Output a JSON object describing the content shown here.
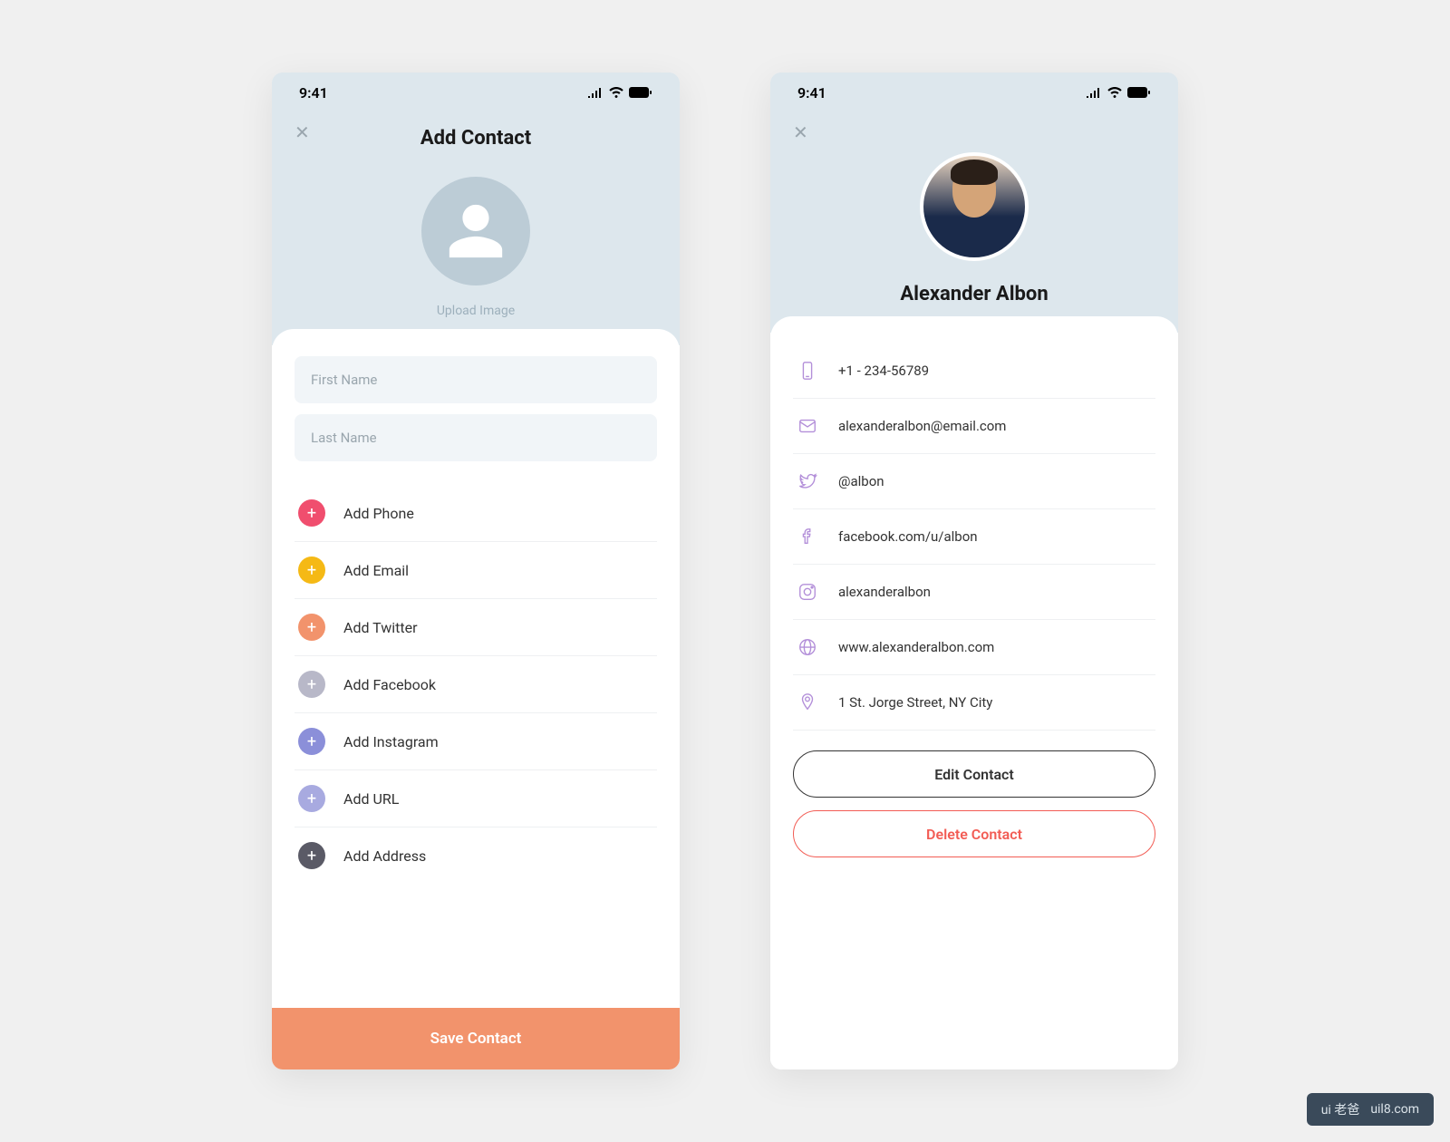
{
  "status": {
    "time": "9:41"
  },
  "screen1": {
    "title": "Add Contact",
    "upload_label": "Upload Image",
    "inputs": {
      "first_name_placeholder": "First Name",
      "last_name_placeholder": "Last Name"
    },
    "add_items": [
      {
        "label": "Add Phone",
        "color": "#f04e6e"
      },
      {
        "label": "Add Email",
        "color": "#f5b915"
      },
      {
        "label": "Add Twitter",
        "color": "#f2936c"
      },
      {
        "label": "Add Facebook",
        "color": "#b8b8c8"
      },
      {
        "label": "Add Instagram",
        "color": "#8b8fd9"
      },
      {
        "label": "Add URL",
        "color": "#a8aae0"
      },
      {
        "label": "Add Address",
        "color": "#5a5a66"
      }
    ],
    "save_label": "Save Contact"
  },
  "screen2": {
    "contact_name": "Alexander Albon",
    "details": [
      {
        "icon": "phone",
        "value": "+1 - 234-56789"
      },
      {
        "icon": "email",
        "value": "alexanderalbon@email.com"
      },
      {
        "icon": "twitter",
        "value": "@albon"
      },
      {
        "icon": "facebook",
        "value": "facebook.com/u/albon"
      },
      {
        "icon": "instagram",
        "value": "alexanderalbon"
      },
      {
        "icon": "globe",
        "value": "www.alexanderalbon.com"
      },
      {
        "icon": "location",
        "value": "1 St. Jorge Street, NY City"
      }
    ],
    "edit_label": "Edit Contact",
    "delete_label": "Delete Contact"
  },
  "watermark": "uil8.com"
}
